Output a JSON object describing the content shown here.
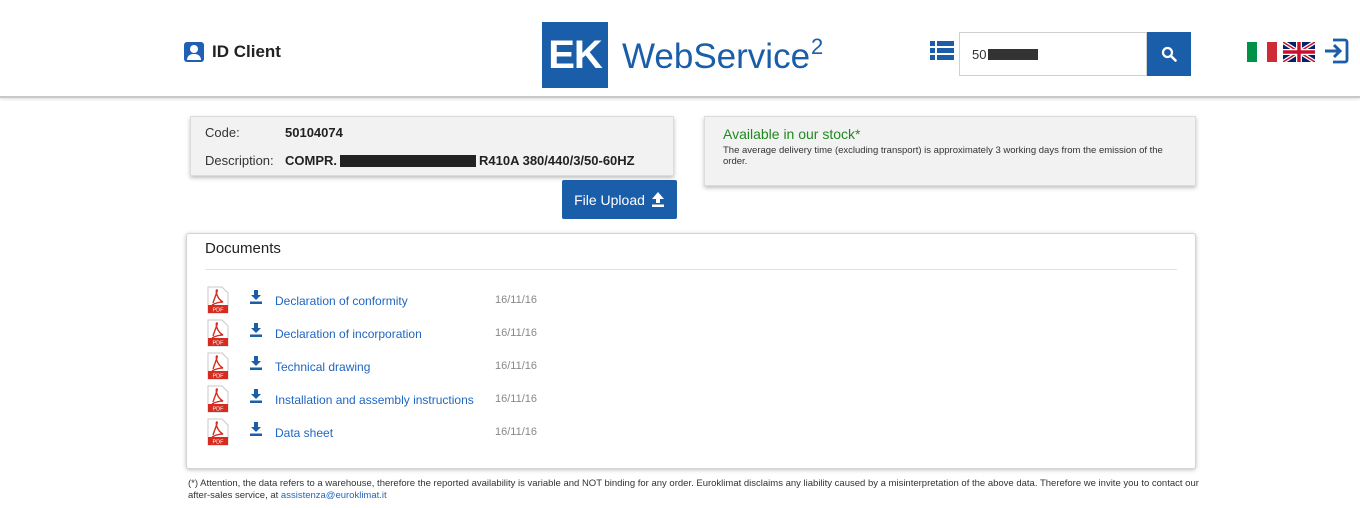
{
  "header": {
    "id_client_label": "ID Client",
    "logo_ek": "EK",
    "logo_text": "WebService",
    "logo_sup": "2",
    "search_value": "50",
    "icons": [
      "user-icon",
      "list-icon",
      "search-icon",
      "flag-it-icon",
      "flag-uk-icon",
      "logout-icon"
    ]
  },
  "product": {
    "code_label": "Code:",
    "code_value": "50104074",
    "description_label": "Description:",
    "description_prefix": "COMPR.",
    "description_suffix": "R410A 380/440/3/50-60HZ"
  },
  "stock": {
    "title": "Available in our stock*",
    "text": "The average delivery time (excluding transport) is approximately 3 working days from the emission of the order."
  },
  "upload": {
    "label": "File Upload"
  },
  "documents": {
    "title": "Documents",
    "items": [
      {
        "name": "Declaration of conformity",
        "date": "16/11/16"
      },
      {
        "name": "Declaration of incorporation",
        "date": "16/11/16"
      },
      {
        "name": "Technical drawing",
        "date": "16/11/16"
      },
      {
        "name": "Installation and assembly instructions",
        "date": "16/11/16"
      },
      {
        "name": "Data sheet",
        "date": "16/11/16"
      }
    ]
  },
  "note": {
    "text": "(*) Attention, the data refers to a warehouse, therefore the reported availability is variable and NOT binding for any order. Euroklimat disclaims any liability caused by a misinterpretation of the above data. Therefore we invite you to contact our after-sales service, at ",
    "email": "assistenza@euroklimat.it"
  },
  "colors": {
    "brand": "#1a5ea9",
    "stock_green": "#1e8a1e",
    "link": "#1f66c1"
  }
}
